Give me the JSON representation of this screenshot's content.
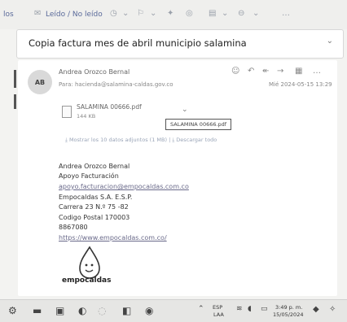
{
  "toolbar": {
    "left_label": "los",
    "read_toggle": "Leído / No leído"
  },
  "email": {
    "subject": "Copia factura mes de abril municipio salamina",
    "avatar_initials": "AB",
    "sender": "Andrea Orozco Bernal",
    "to": "Para: hacienda@salamina-caldas.gov.co",
    "date": "Mié 2024-05-15 13:29",
    "attachment": {
      "name": "SALAMINA 00666.pdf",
      "size": "144 KB"
    },
    "tooltip": "SALAMINA 00666.pdf",
    "save_all": "Mostrar los 10 datos adjuntos (1 MB)",
    "download_all": "Descargar todo",
    "signature": [
      "Andrea Orozco Bernal",
      "Apoyo Facturación",
      "apoyo.facturacion@empocaldas.com.co",
      "Empocaldas S.A. E.S.P.",
      "Carrera 23 N.º 75 -82",
      "Codigo Postal 170003",
      "8867080",
      "https://www.empocaldas.com.co/"
    ],
    "logo_text": "empocaldas"
  },
  "taskbar": {
    "lang": "ESP",
    "lang2": "LAA",
    "time": "3:49 p. m.",
    "date": "15/05/2024"
  },
  "colors": {
    "accent": "#5a6a9a",
    "link": "#6a6a8a"
  }
}
